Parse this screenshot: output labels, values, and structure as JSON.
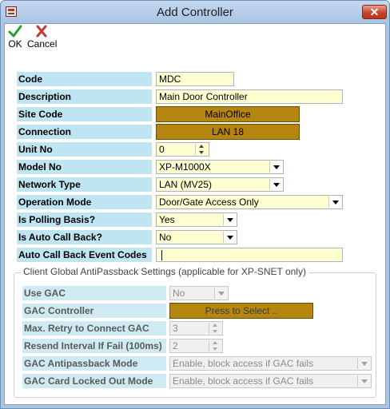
{
  "window": {
    "title": "Add Controller",
    "close_label": "✕"
  },
  "toolbar": {
    "ok_label": "OK",
    "cancel_label": "Cancel"
  },
  "fields": {
    "code": {
      "label": "Code",
      "value": "MDC"
    },
    "description": {
      "label": "Description",
      "value": "Main Door Controller"
    },
    "site_code": {
      "label": "Site Code",
      "value": "MainOffice"
    },
    "connection": {
      "label": "Connection",
      "value": "LAN 18"
    },
    "unit_no": {
      "label": "Unit No",
      "value": "0"
    },
    "model_no": {
      "label": "Model No",
      "value": "XP-M1000X"
    },
    "network_type": {
      "label": "Network Type",
      "value": "LAN (MV25)"
    },
    "operation_mode": {
      "label": "Operation Mode",
      "value": "Door/Gate Access Only"
    },
    "polling_basis": {
      "label": "Is Polling Basis?",
      "value": "Yes"
    },
    "auto_call_back": {
      "label": "Is Auto Call Back?",
      "value": "No"
    },
    "auto_call_back_codes": {
      "label": "Auto Call Back Event Codes",
      "value": ""
    }
  },
  "gac_group": {
    "title": "Client Global AntiPassback Settings (applicable for XP-SNET only)",
    "use_gac": {
      "label": "Use GAC",
      "value": "No"
    },
    "gac_controller": {
      "label": "GAC Controller",
      "value": "Press to Select .."
    },
    "max_retry": {
      "label": "Max. Retry to Connect GAC",
      "value": "3"
    },
    "resend_interval": {
      "label": "Resend Interval If Fail (100ms)",
      "value": "2"
    },
    "antipassback_mode": {
      "label": "GAC Antipassback Mode",
      "value": "Enable, block access if GAC fails"
    },
    "card_locked_mode": {
      "label": "GAC Card Locked Out Mode",
      "value": "Enable, block access if GAC fails"
    }
  },
  "colors": {
    "label_bg": "#bfe5f2",
    "field_yellow": "#ffffd2",
    "selector_button": "#b5860f",
    "ok_icon": "#2e9b2e",
    "cancel_icon": "#c23a3a"
  },
  "icons": [
    "app-icon",
    "close-icon",
    "checkmark-icon",
    "x-cancel-icon",
    "chevron-down-icon",
    "spinner-icon"
  ]
}
